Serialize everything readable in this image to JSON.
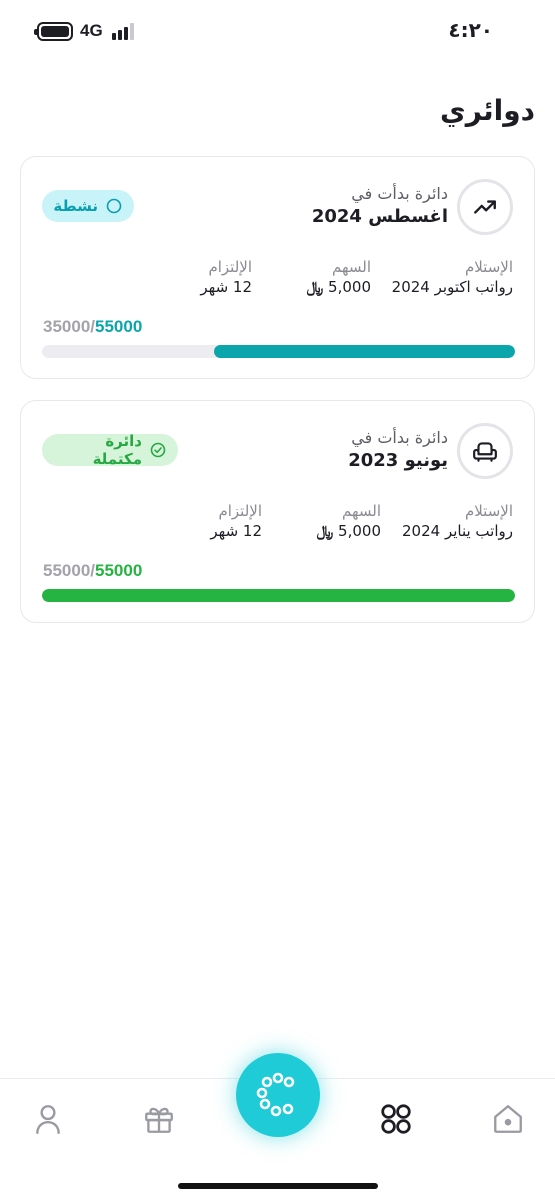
{
  "status_bar": {
    "network": "4G",
    "time": "٤:٢٠"
  },
  "page_title": "دوائري",
  "circles": [
    {
      "icon": "trending-up-icon",
      "started_label": "دائرة بدأت في",
      "started_value": "اغسطس 2024",
      "status": "نشطة",
      "status_icon": "circle-outline-icon",
      "receipt_label": "الإستلام",
      "receipt_value": "رواتب اكتوبر 2024",
      "share_label": "السهم",
      "share_value": "5,000",
      "currency_symbol": "⃁",
      "commitment_label": "الإلتزام",
      "commitment_value": "12 شهر",
      "paid": "35000",
      "separator": "/",
      "total": "55000",
      "progress_fraction": 0.636,
      "accent_color": "#0aa6ac"
    },
    {
      "icon": "armchair-icon",
      "started_label": "دائرة بدأت في",
      "started_value": "يونيو 2023",
      "status": "دائرة مكتملة",
      "status_icon": "check-circle-icon",
      "receipt_label": "الإستلام",
      "receipt_value": "رواتب يناير 2024",
      "share_label": "السهم",
      "share_value": "5,000",
      "currency_symbol": "⃁",
      "commitment_label": "الإلتزام",
      "commitment_value": "12 شهر",
      "paid": "55000",
      "separator": "/",
      "total": "55000",
      "progress_fraction": 1.0,
      "accent_color": "#25b341"
    }
  ],
  "bottom_nav": {
    "items": [
      "profile-icon",
      "gift-icon",
      "circles-app-icon",
      "grid-icon",
      "home-icon"
    ],
    "active": "grid-icon",
    "center_color": "#1fcbd6"
  }
}
